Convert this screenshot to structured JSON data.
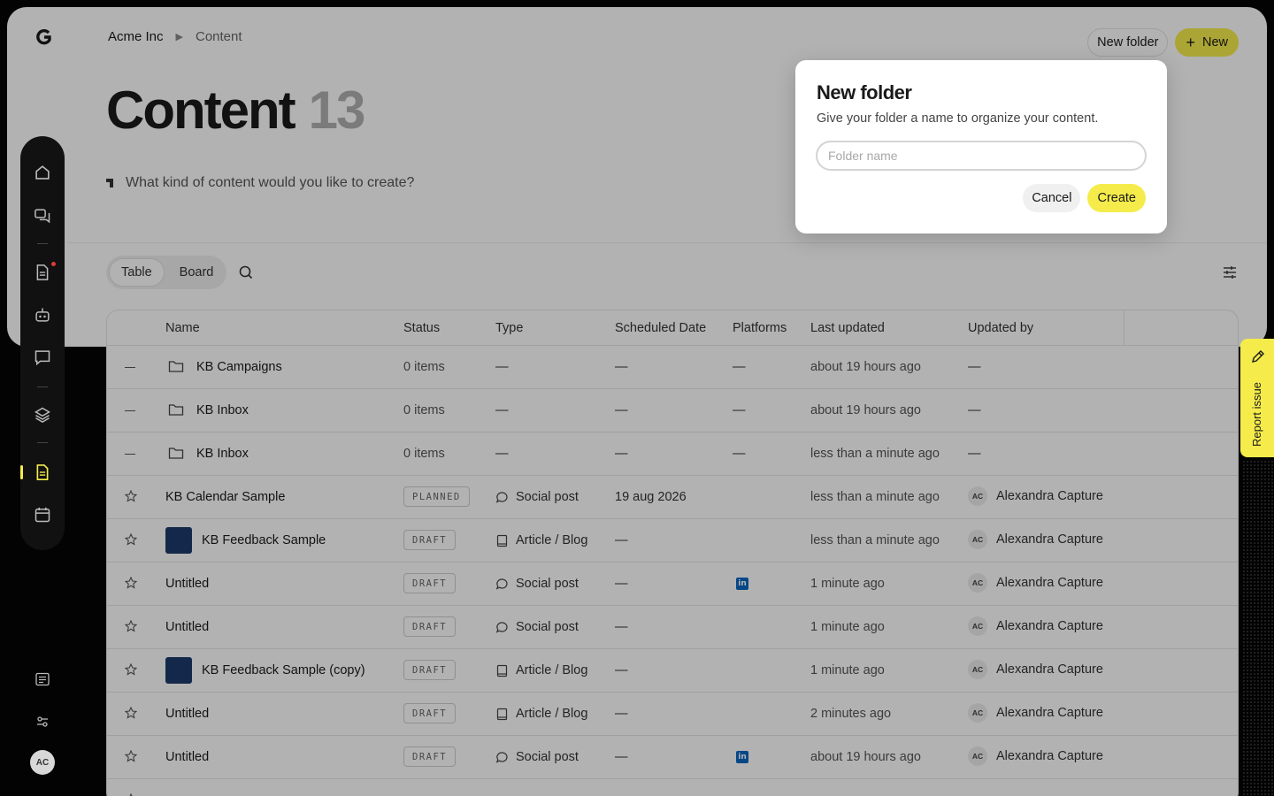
{
  "breadcrumb": {
    "org": "Acme Inc",
    "current": "Content"
  },
  "header": {
    "new_folder_label": "New folder",
    "new_label": "New",
    "plus_glyph": "+"
  },
  "page": {
    "title": "Content",
    "count": "13",
    "prompt": "What kind of content would you like to create?"
  },
  "toolbar": {
    "table_label": "Table",
    "board_label": "Board"
  },
  "columns": {
    "name": "Name",
    "status": "Status",
    "type": "Type",
    "scheduled": "Scheduled Date",
    "platforms": "Platforms",
    "updated": "Last updated",
    "updated_by": "Updated by"
  },
  "rows": [
    {
      "name": "KB Campaigns",
      "status": "0 items",
      "type": "—",
      "scheduled": "—",
      "platforms": "—",
      "updated": "about 19 hours ago",
      "updated_by": "—"
    },
    {
      "name": "KB Inbox",
      "status": "0 items",
      "type": "—",
      "scheduled": "—",
      "platforms": "—",
      "updated": "about 19 hours ago",
      "updated_by": "—"
    },
    {
      "name": "KB Inbox",
      "status": "0 items",
      "type": "—",
      "scheduled": "—",
      "platforms": "—",
      "updated": "less than a minute ago",
      "updated_by": "—"
    },
    {
      "name": "KB Calendar Sample",
      "status": "PLANNED",
      "type": "Social post",
      "scheduled": "19 aug 2026",
      "updated": "less than a minute ago",
      "initials": "AC",
      "updated_by": "Alexandra Capture"
    },
    {
      "name": "KB Feedback Sample",
      "status": "DRAFT",
      "type": "Article / Blog",
      "scheduled": "—",
      "updated": "less than a minute ago",
      "initials": "AC",
      "updated_by": "Alexandra Capture"
    },
    {
      "name": "Untitled",
      "status": "DRAFT",
      "type": "Social post",
      "scheduled": "—",
      "platform_icon": "in",
      "updated": "1 minute ago",
      "initials": "AC",
      "updated_by": "Alexandra Capture"
    },
    {
      "name": "Untitled",
      "status": "DRAFT",
      "type": "Social post",
      "scheduled": "—",
      "updated": "1 minute ago",
      "initials": "AC",
      "updated_by": "Alexandra Capture"
    },
    {
      "name": "KB Feedback Sample (copy)",
      "status": "DRAFT",
      "type": "Article / Blog",
      "scheduled": "—",
      "updated": "1 minute ago",
      "initials": "AC",
      "updated_by": "Alexandra Capture"
    },
    {
      "name": "Untitled",
      "status": "DRAFT",
      "type": "Article / Blog",
      "scheduled": "—",
      "updated": "2 minutes ago",
      "initials": "AC",
      "updated_by": "Alexandra Capture"
    },
    {
      "name": "Untitled",
      "status": "DRAFT",
      "type": "Social post",
      "scheduled": "—",
      "platform_icon": "in",
      "updated": "about 19 hours ago",
      "initials": "AC",
      "updated_by": "Alexandra Capture"
    }
  ],
  "user": {
    "initials": "AC"
  },
  "report": {
    "label": "Report issue"
  },
  "dialog": {
    "title": "New folder",
    "description": "Give your folder a name to organize your content.",
    "input_placeholder": "Folder name",
    "input_value": "",
    "cancel_label": "Cancel",
    "create_label": "Create"
  },
  "colors": {
    "accent": "#f5ec4c",
    "linkedin": "#0a66c2",
    "thumb": "#1c3a6b"
  }
}
